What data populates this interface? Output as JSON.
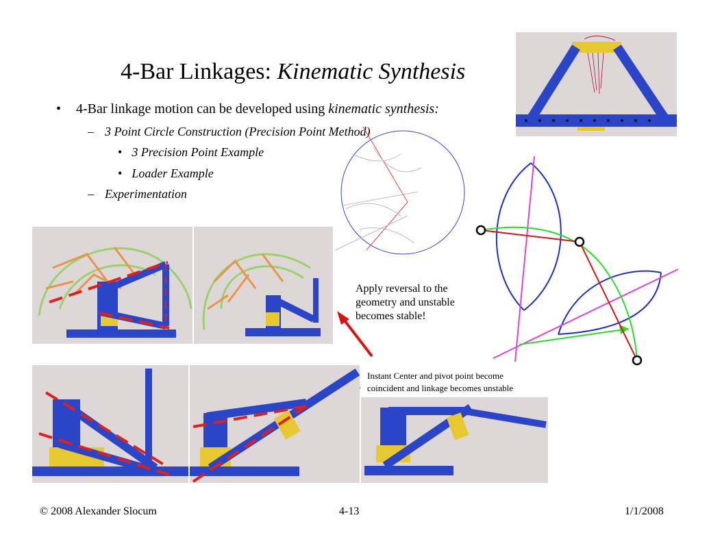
{
  "slide": {
    "title_plain": "4-Bar Linkages: ",
    "title_italic": "Kinematic Synthesis",
    "bullet_main_plain": "4-Bar linkage motion can be developed using ",
    "bullet_main_italic": "kinematic synthesis:",
    "sub1": "3 Point Circle Construction (Precision Point Method)",
    "sub1_items": [
      "3 Precision Point Example",
      "Loader Example"
    ],
    "sub2": "Experimentation",
    "bullet_char": "•",
    "dash_char": "–",
    "note_reversal": [
      "Apply reversal to the",
      "geometry and unstable",
      "becomes stable!"
    ],
    "note_instant": [
      "Instant Center and pivot point become",
      "coincident and linkage becomes unstable"
    ]
  },
  "footer": {
    "copyright": "© 2008 Alexander Slocum",
    "page": "4-13",
    "date": "1/1/2008"
  },
  "colors": {
    "link_blue": "#2a45c8",
    "dashed_red": "#e0201a",
    "arc_green": "#9bd06a",
    "orange": "#e8944a",
    "construct_blue": "#1a2fd0",
    "construct_magenta": "#e040e0",
    "construct_green": "#22e022",
    "construct_red": "#e01010",
    "yellow_block": "#e8c830",
    "photo_bg": "#ddd7d8"
  }
}
